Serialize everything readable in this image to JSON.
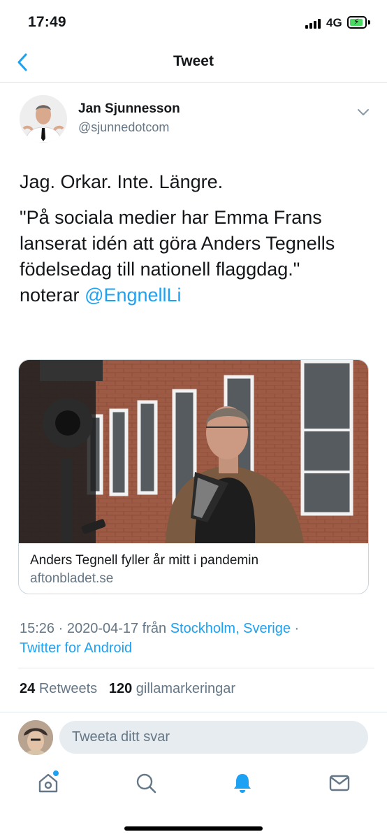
{
  "status_bar": {
    "time": "17:49",
    "network": "4G"
  },
  "nav": {
    "title": "Tweet"
  },
  "author": {
    "name": "Jan Sjunnesson",
    "handle": "@sjunnedotcom"
  },
  "tweet": {
    "line1": "Jag. Orkar. Inte. Längre.",
    "quote": "\"På sociala medier har Emma Frans lanserat idén att göra Anders Tegnells födelsedag till nationell flaggdag.\"",
    "noted_prefix": "noterar ",
    "mention": "@EngnellLi"
  },
  "link_card": {
    "title": "Anders Tegnell fyller år mitt i pandemin",
    "domain": "aftonbladet.se"
  },
  "meta": {
    "time_date": "15:26 · 2020-04-17 från ",
    "location": "Stockholm, Sverige",
    "separator": " ·",
    "client": "Twitter for Android"
  },
  "stats": {
    "retweets_count": "24",
    "retweets_label": "Retweets",
    "likes_count": "120",
    "likes_label": "gillamarkeringar"
  },
  "reply": {
    "placeholder": "Tweeta ditt svar"
  },
  "tab_bar": {
    "items": [
      {
        "icon": "home-icon",
        "active": false,
        "has_dot": true
      },
      {
        "icon": "search-icon",
        "active": false
      },
      {
        "icon": "notifications-bell-icon",
        "active": true
      },
      {
        "icon": "messages-mail-icon",
        "active": false
      }
    ]
  },
  "colors": {
    "accent": "#1da1f2",
    "text": "#14171a",
    "secondary": "#657786",
    "divider": "#e1e8ed"
  }
}
